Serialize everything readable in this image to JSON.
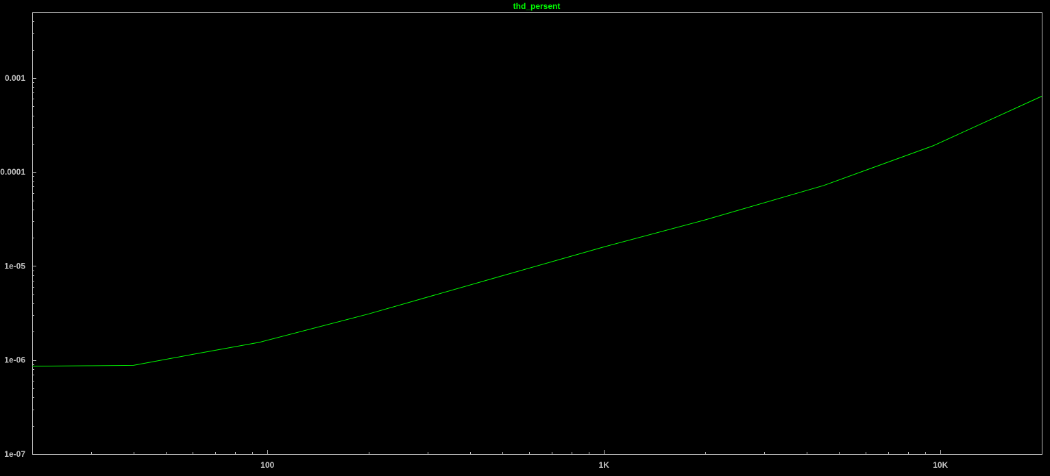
{
  "chart_data": {
    "type": "line",
    "title": "thd_persent",
    "x_scale": "log",
    "y_scale": "log",
    "xlim": [
      20,
      20000
    ],
    "ylim": [
      1e-07,
      0.005
    ],
    "x_ticks": [
      {
        "value": 100,
        "label": "100"
      },
      {
        "value": 1000,
        "label": "1K"
      },
      {
        "value": 10000,
        "label": "10K"
      }
    ],
    "y_ticks": [
      {
        "value": 1e-07,
        "label": "1e-07"
      },
      {
        "value": 1e-06,
        "label": "1e-06"
      },
      {
        "value": 1e-05,
        "label": "1e-05"
      },
      {
        "value": 0.0001,
        "label": "0.0001"
      },
      {
        "value": 0.001,
        "label": "0.001"
      }
    ],
    "grid": false,
    "series": [
      {
        "color": "#00ff00",
        "points": [
          [
            20,
            8.6e-07
          ],
          [
            30,
            8.7e-07
          ],
          [
            40,
            8.8e-07
          ],
          [
            60,
            1.15e-06
          ],
          [
            95,
            1.55e-06
          ],
          [
            200,
            3.1e-06
          ],
          [
            500,
            7.9e-06
          ],
          [
            1000,
            1.6e-05
          ],
          [
            2000,
            3.1e-05
          ],
          [
            4500,
            7.2e-05
          ],
          [
            9500,
            0.00019
          ],
          [
            20000,
            0.00064
          ]
        ]
      }
    ]
  },
  "colors": {
    "background": "#000000",
    "axis": "#c0c0c0",
    "tick_label": "#c0c0c0",
    "title": "#00ff00"
  }
}
